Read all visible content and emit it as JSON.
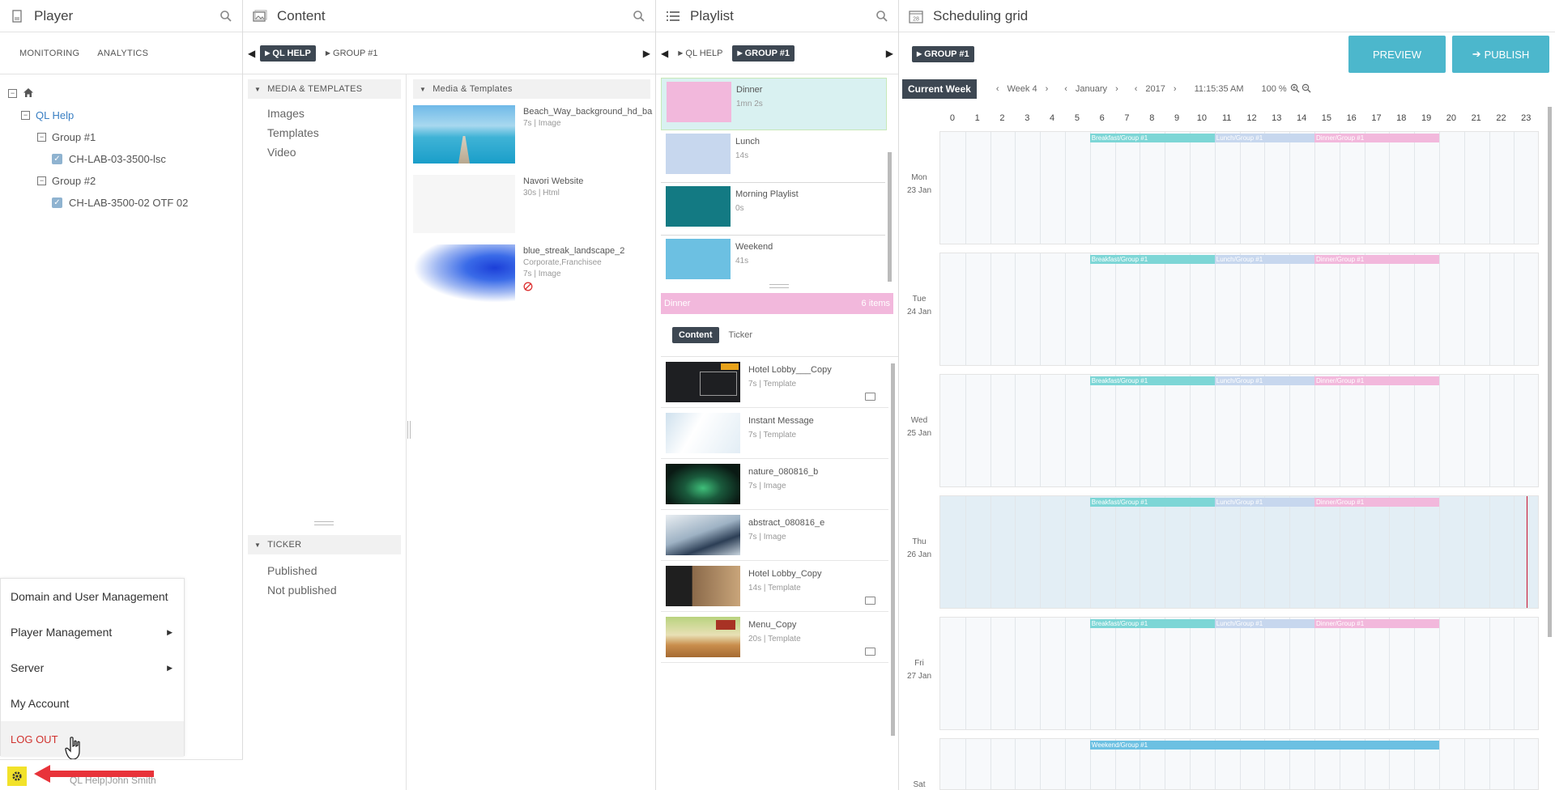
{
  "player": {
    "title": "Player",
    "tabs": [
      "MONITORING",
      "ANALYTICS"
    ],
    "tree": {
      "root": "QL Help",
      "groups": [
        {
          "label": "Group #1",
          "player": "CH-LAB-03-3500-lsc"
        },
        {
          "label": "Group #2",
          "player": "CH-LAB-3500-02 OTF 02"
        }
      ]
    },
    "menu": {
      "items": [
        "Domain and User Management",
        "Player Management",
        "Server",
        "My Account"
      ],
      "logout": "LOG OUT"
    },
    "footer_user": "QL Help|John Smith"
  },
  "content": {
    "title": "Content",
    "breadcrumb": [
      "QL HELP",
      "GROUP #1"
    ],
    "left_section": "MEDIA & TEMPLATES",
    "left_items": [
      "Images",
      "Templates",
      "Video"
    ],
    "ticker_section": "TICKER",
    "ticker_items": [
      "Published",
      "Not published"
    ],
    "right_section": "Media & Templates",
    "media": [
      {
        "title": "Beach_Way_background_hd_ba",
        "duration": "7s",
        "type": "Image",
        "tags": ""
      },
      {
        "title": "Navori Website",
        "duration": "30s",
        "type": "Html",
        "tags": ""
      },
      {
        "title": "blue_streak_landscape_2",
        "duration": "7s",
        "type": "Image",
        "tags": "Corporate,Franchisee"
      }
    ]
  },
  "playlist": {
    "title": "Playlist",
    "breadcrumb": [
      "QL HELP",
      "GROUP #1"
    ],
    "items": [
      {
        "title": "Dinner",
        "duration": "1mn 2s",
        "color": "#f2b8dc"
      },
      {
        "title": "Lunch",
        "duration": "14s",
        "color": "#c7d7ee"
      },
      {
        "title": "Morning Playlist",
        "duration": "0s",
        "color": "#137a83"
      },
      {
        "title": "Weekend",
        "duration": "41s",
        "color": "#6cc0e2"
      }
    ],
    "selected_header": {
      "name": "Dinner",
      "count": "6 items"
    },
    "subtabs": [
      "Content",
      "Ticker"
    ],
    "contents": [
      {
        "title": "Hotel Lobby___Copy",
        "duration": "7s",
        "type": "Template"
      },
      {
        "title": "Instant Message",
        "duration": "7s",
        "type": "Template"
      },
      {
        "title": "nature_080816_b",
        "duration": "7s",
        "type": "Image"
      },
      {
        "title": "abstract_080816_e",
        "duration": "7s",
        "type": "Image"
      },
      {
        "title": "Hotel Lobby_Copy",
        "duration": "14s",
        "type": "Template"
      },
      {
        "title": "Menu_Copy",
        "duration": "20s",
        "type": "Template"
      }
    ]
  },
  "schedule": {
    "title": "Scheduling grid",
    "calendar_number": "28",
    "breadcrumb": "GROUP #1",
    "preview": "PREVIEW",
    "publish": "PUBLISH",
    "current_week": "Current Week",
    "week": "Week 4",
    "month": "January",
    "year": "2017",
    "time": "11:15:35 AM",
    "zoom": "100 %",
    "hours": [
      "0",
      "1",
      "2",
      "3",
      "4",
      "5",
      "6",
      "7",
      "8",
      "9",
      "10",
      "11",
      "12",
      "13",
      "14",
      "15",
      "16",
      "17",
      "18",
      "19",
      "20",
      "21",
      "22",
      "23"
    ],
    "days": [
      {
        "dow": "Mon",
        "date": "23 Jan"
      },
      {
        "dow": "Tue",
        "date": "24 Jan"
      },
      {
        "dow": "Wed",
        "date": "25 Jan"
      },
      {
        "dow": "Thu",
        "date": "26 Jan"
      },
      {
        "dow": "Fri",
        "date": "27 Jan"
      },
      {
        "dow": "Sat",
        "date": ""
      }
    ],
    "weekday_slots": [
      {
        "label": "Breakfast/Group #1",
        "start": 6,
        "end": 11,
        "color": "#7dd6d6"
      },
      {
        "label": "Lunch/Group #1",
        "start": 11,
        "end": 15,
        "color": "#c7d7ee"
      },
      {
        "label": "Dinner/Group #1",
        "start": 15,
        "end": 20,
        "color": "#f2b8dc"
      }
    ],
    "weekend_slot": {
      "label": "Weekend/Group #1",
      "start": 6,
      "end": 20,
      "color": "#6cc0e2"
    },
    "today_index": 3,
    "now_hour": 23.5
  }
}
